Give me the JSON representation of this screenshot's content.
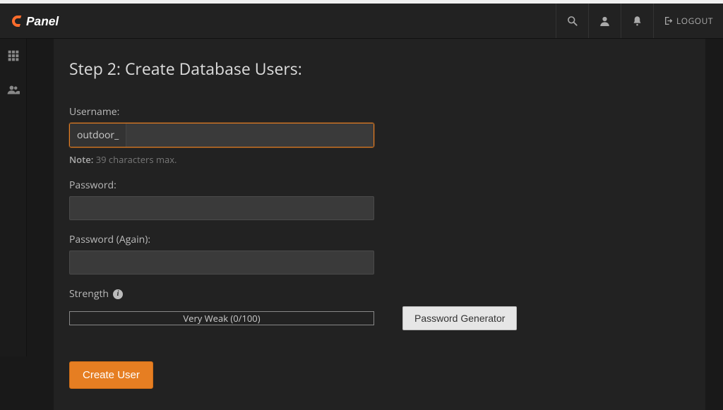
{
  "header": {
    "brand": "cPanel",
    "logout_label": "LOGOUT"
  },
  "page": {
    "title": "Step 2: Create Database Users:"
  },
  "form": {
    "username_label": "Username:",
    "username_prefix": "outdoor_",
    "username_value": "",
    "note_bold": "Note:",
    "note_text": " 39 characters max.",
    "password_label": "Password:",
    "password_value": "",
    "password_again_label": "Password (Again):",
    "password_again_value": "",
    "strength_label": "Strength",
    "strength_text": "Very Weak (0/100)",
    "pwgen_label": "Password Generator",
    "submit_label": "Create User"
  }
}
